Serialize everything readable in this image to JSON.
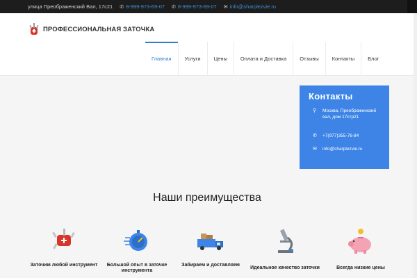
{
  "topbar": {
    "address": "улица Преображенский Вал, 17с21",
    "phone1": "8-999-973-69-07",
    "phone2": "8-999-973-69-07",
    "email": "info@sharplezvie.ru",
    "icons": [
      "phone-icon",
      "phone-icon",
      "mail-icon"
    ]
  },
  "logo": {
    "text": "ПРОФЕССИОНАЛЬНАЯ ЗАТОЧКА",
    "icon": "knife-icon"
  },
  "nav": {
    "items": [
      "Главная",
      "Услуги",
      "Цены",
      "Оплата и Доставка",
      "Отзывы",
      "Контакты",
      "Блог"
    ],
    "active": "Главная"
  },
  "contacts": {
    "title": "Контакты",
    "address": "Москва, Преображенский вал, дом 17стр21",
    "phone": "+7(977)355-76-84",
    "email": "info@sharplezvie.ru",
    "bg_color": "#3d84e6"
  },
  "advantages": {
    "title": "Наши преимущества",
    "items": [
      {
        "label": "Заточим любой инструмент",
        "icon": "swiss-knife-icon"
      },
      {
        "label": "Большой опыт в заточке инструмента",
        "icon": "stopwatch-icon"
      },
      {
        "label": "Забираем и доставляем",
        "icon": "truck-icon"
      },
      {
        "label": "Идеальное качество заточки",
        "icon": "microscope-icon"
      },
      {
        "label": "Всегда низкие цены",
        "icon": "piggy-bank-icon"
      }
    ]
  },
  "colors": {
    "accent": "#2f7fd1",
    "topbar_bg": "#1d1d1d"
  }
}
